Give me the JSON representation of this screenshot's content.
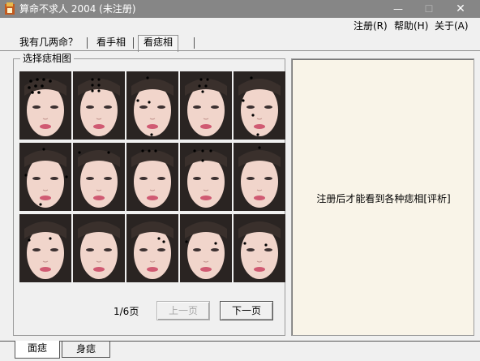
{
  "window": {
    "title": "算命不求人 2004 (未注册)",
    "controls": {
      "minimize": "—",
      "maximize": "☐",
      "close": "✕"
    }
  },
  "menu": [
    {
      "label": "注册(R)"
    },
    {
      "label": "帮助(H)"
    },
    {
      "label": "关于(A)"
    }
  ],
  "tabs": [
    {
      "label": "我有几两命？",
      "active": false
    },
    {
      "label": "看手相",
      "active": false
    },
    {
      "label": "看痣相",
      "active": true
    }
  ],
  "group": {
    "label": "选择痣相图"
  },
  "face_grid": {
    "rows": 3,
    "cols": 5,
    "count": 15
  },
  "pager": {
    "page_label": "1/6页",
    "prev_label": "上一页",
    "next_label": "下一页",
    "prev_enabled": false
  },
  "result": {
    "message": "注册后才能看到各种痣相[评析]"
  },
  "bottom_tabs": [
    {
      "label": "面痣",
      "active": true
    },
    {
      "label": "身痣",
      "active": false
    }
  ],
  "colors": {
    "titlebar": "#868686",
    "result_bg": "#f9f4e8",
    "panel": "#f0f0f0"
  }
}
